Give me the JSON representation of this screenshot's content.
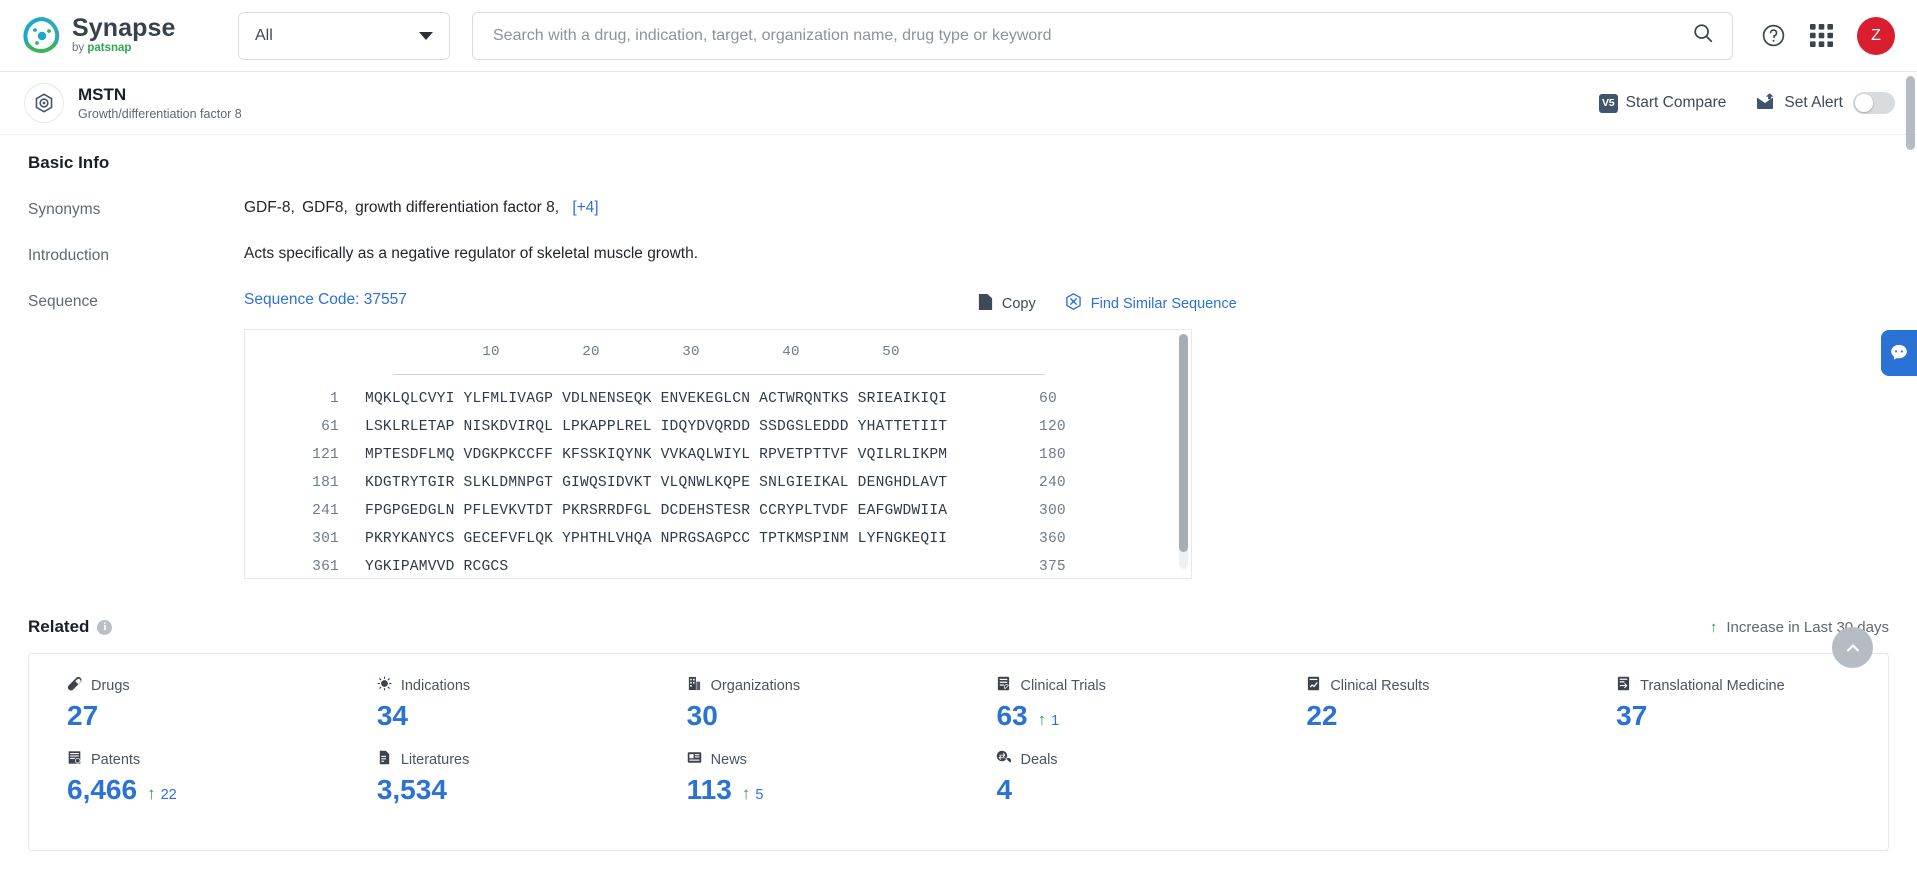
{
  "topbar": {
    "brand_name": "Synapse",
    "brand_by": "by ",
    "brand_company": "patsnap",
    "category_select": "All",
    "search_placeholder": "Search with a drug, indication, target, organization name, drug type or keyword",
    "search_value": "",
    "avatar_initial": "Z",
    "accent_blue": "#2a72d4",
    "avatar_color": "#d81e2f"
  },
  "entity": {
    "name": "MSTN",
    "subtitle": "Growth/differentiation factor 8",
    "start_compare": "Start Compare",
    "vs_badge": "V5",
    "set_alert": "Set Alert",
    "alert_enabled": false
  },
  "basic_info": {
    "title": "Basic Info",
    "synonyms_label": "Synonyms",
    "synonyms": [
      "GDF-8,",
      "GDF8,",
      "growth differentiation factor 8,"
    ],
    "synonyms_more": "[+4]",
    "introduction_label": "Introduction",
    "introduction": "Acts specifically as a negative regulator of skeletal muscle growth.",
    "sequence_label": "Sequence",
    "sequence_code": "Sequence Code: 37557",
    "copy_label": "Copy",
    "find_similar_label": "Find Similar Sequence"
  },
  "sequence": {
    "ruler_ticks": [
      10,
      20,
      30,
      40,
      50
    ],
    "rows": [
      {
        "start": "1",
        "chunks": "MQKLQLCVYI YLFMLIVAGP VDLNENSEQK ENVEKEGLCN ACTWRQNTKS SRIEAIKIQI",
        "end": "60"
      },
      {
        "start": "61",
        "chunks": "LSKLRLETAP NISKDVIRQL LPKAPPLREL IDQYDVQRDD SSDGSLEDDD YHATTETIIT",
        "end": "120"
      },
      {
        "start": "121",
        "chunks": "MPTESDFLMQ VDGKPKCCFF KFSSKIQYNK VVKAQLWIYL RPVETPTTVF VQILRLIKPM",
        "end": "180"
      },
      {
        "start": "181",
        "chunks": "KDGTRYTGIR SLKLDMNPGT GIWQSIDVKT VLQNWLKQPE SNLGIEIKAL DENGHDLAVT",
        "end": "240"
      },
      {
        "start": "241",
        "chunks": "FPGPGEDGLN PFLEVKVTDT PKRSRRDFGL DCDEHSTESR CCRYPLTVDF EAFGWDWIIA",
        "end": "300"
      },
      {
        "start": "301",
        "chunks": "PKRYKANYCS GECEFVFLQK YPHTHLVHQA NPRGSAGPCC TPTKMSPINM LYFNGKEQII",
        "end": "360"
      },
      {
        "start": "361",
        "chunks": "YGKIPAMVVD RCGCS",
        "end": "375"
      }
    ]
  },
  "related": {
    "title": "Related",
    "increase_note": "Increase in Last 30 days",
    "stats": [
      {
        "label": "Drugs",
        "icon": "pill-icon",
        "value": "27",
        "delta": null
      },
      {
        "label": "Indications",
        "icon": "virus-icon",
        "value": "34",
        "delta": null
      },
      {
        "label": "Organizations",
        "icon": "building-icon",
        "value": "30",
        "delta": null
      },
      {
        "label": "Clinical Trials",
        "icon": "clinical-trial-icon",
        "value": "63",
        "delta": "1"
      },
      {
        "label": "Clinical Results",
        "icon": "clinical-result-icon",
        "value": "22",
        "delta": null
      },
      {
        "label": "Translational Medicine",
        "icon": "translational-medicine-icon",
        "value": "37",
        "delta": null
      },
      {
        "label": "Patents",
        "icon": "patent-icon",
        "value": "6,466",
        "delta": "22"
      },
      {
        "label": "Literatures",
        "icon": "literature-icon",
        "value": "3,534",
        "delta": null
      },
      {
        "label": "News",
        "icon": "news-icon",
        "value": "113",
        "delta": "5"
      },
      {
        "label": "Deals",
        "icon": "deals-icon",
        "value": "4",
        "delta": null
      }
    ]
  }
}
